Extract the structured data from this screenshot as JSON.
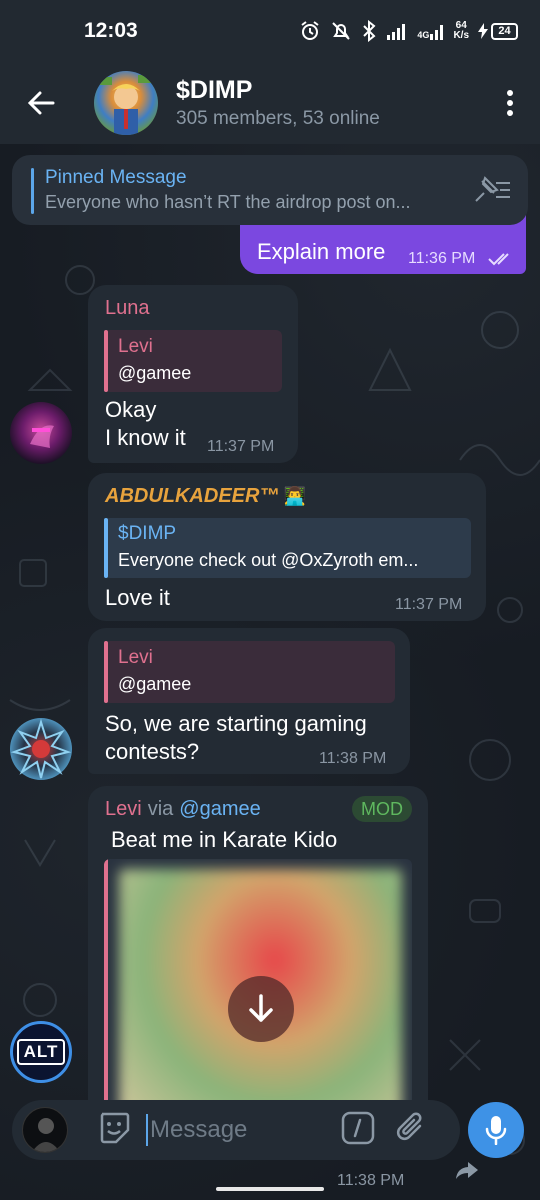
{
  "status_bar": {
    "time": "12:03",
    "network": "4G",
    "speed_value": "64",
    "speed_unit": "K/s",
    "battery": "24"
  },
  "header": {
    "title": "$DIMP",
    "subtitle": "305 members, 53 online"
  },
  "pinned": {
    "title": "Pinned Message",
    "text": "Everyone who hasn’t RT the airdrop post on..."
  },
  "messages": [
    {
      "text": "Explain more",
      "time": "11:36 PM"
    },
    {
      "sender": "Luna",
      "reply_name": "Levi",
      "reply_text": "@gamee",
      "line1": "Okay",
      "line2": "I know it",
      "time": "11:37 PM"
    },
    {
      "sender": "ABDULKADEER™",
      "sender_emoji": "👨‍💻",
      "reply_name": "$DIMP",
      "reply_text": "Everyone check out @OxZyroth em...",
      "text": "Love it",
      "time": "11:37 PM"
    },
    {
      "reply_name": "Levi",
      "reply_text": "@gamee",
      "line1": "So, we are starting gaming",
      "line2": "contests?",
      "time": "11:38 PM"
    },
    {
      "sender": "Levi",
      "via": "via",
      "bot": "@gamee",
      "badge": "MOD",
      "text": "Beat me in Karate Kido"
    }
  ],
  "avatar_labels": {
    "alt": "ALT"
  },
  "footer_time": "11:38 PM",
  "input": {
    "placeholder": "Message"
  },
  "colors": {
    "accent": "#3e92e6",
    "outgoing_bubble": "#7b48e0",
    "pink_name": "#e0718f",
    "blue_name": "#6ab3f3",
    "gold_name": "#e8a33d",
    "mod_badge": "#5fb85f"
  }
}
